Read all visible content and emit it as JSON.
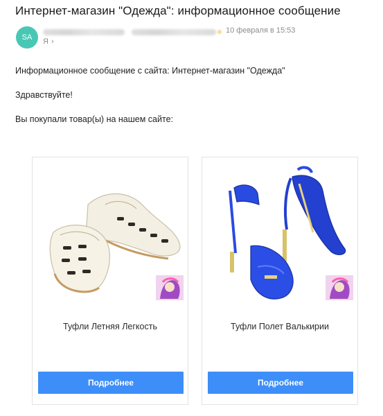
{
  "email": {
    "subject": "Интернет-магазин \"Одежда\": информационное сообщение",
    "avatar_initials": "SA",
    "date": "10 февраля в 15:53",
    "recipient": "Я",
    "recipient_chevron": "›"
  },
  "body": {
    "line1": "Информационное сообщение с сайта: Интернет-магазин \"Одежда\"",
    "line2": "Здравствуйте!",
    "line3": "Вы покупали товар(ы) на нашем сайте:"
  },
  "products": [
    {
      "name": "Туфли Летняя Легкость",
      "button_label": "Подробнее",
      "color": "#efe9d8"
    },
    {
      "name": "Туфли Полет Валькирии",
      "button_label": "Подробнее",
      "color": "#2f4fd8"
    }
  ],
  "colors": {
    "avatar_bg": "#48c8b4",
    "button_bg": "#3d8ef8",
    "muted_text": "#8c8c8c"
  }
}
